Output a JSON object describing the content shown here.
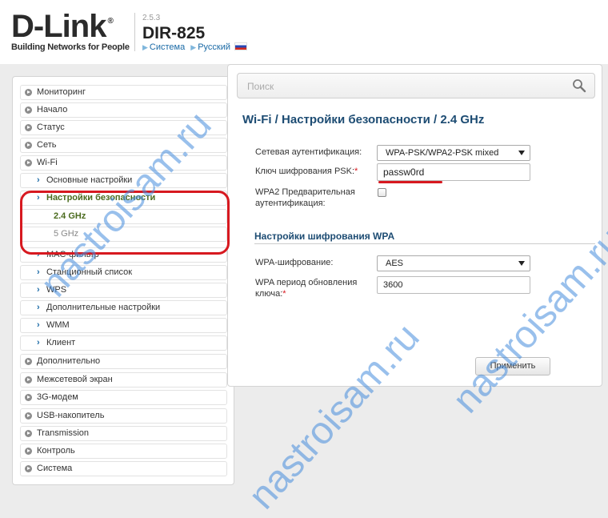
{
  "header": {
    "brand": "D-Link",
    "brand_mark": "®",
    "tagline": "Building Networks for People",
    "firmware": "2.5.3",
    "model": "DIR-825",
    "links": [
      "Система",
      "Русский"
    ]
  },
  "sidebar": {
    "items": [
      {
        "label": "Мониторинг"
      },
      {
        "label": "Начало"
      },
      {
        "label": "Статус"
      },
      {
        "label": "Сеть"
      },
      {
        "label": "Wi-Fi"
      },
      {
        "label": "Основные настройки"
      },
      {
        "label": "Настройки безопасности"
      },
      {
        "label": "2.4 GHz"
      },
      {
        "label": "5 GHz"
      },
      {
        "label": "MAC-фильтр"
      },
      {
        "label": "Станционный список"
      },
      {
        "label": "WPS"
      },
      {
        "label": "Дополнительные настройки"
      },
      {
        "label": "WMM"
      },
      {
        "label": "Клиент"
      },
      {
        "label": "Дополнительно"
      },
      {
        "label": "Межсетевой экран"
      },
      {
        "label": "3G-модем"
      },
      {
        "label": "USB-накопитель"
      },
      {
        "label": "Transmission"
      },
      {
        "label": "Контроль"
      },
      {
        "label": "Система"
      }
    ]
  },
  "search": {
    "placeholder": "Поиск"
  },
  "page": {
    "title": "Wi-Fi /  Настройки безопасности /  2.4 GHz",
    "auth_label": "Сетевая аутентификация:",
    "auth_value": "WPA-PSK/WPA2-PSK mixed",
    "psk_label": "Ключ шифрования PSK:",
    "psk_value": "passw0rd",
    "preauth_label_line1": "WPA2 Предварительная",
    "preauth_label_line2": "аутентификация:",
    "preauth_checked": false,
    "wpa_section": "Настройки шифрования WPA",
    "enc_label": "WPA-шифрование:",
    "enc_value": "AES",
    "period_label_line1": "WPA период обновления",
    "period_label_line2": "ключа:",
    "period_value": "3600",
    "required_mark": "*",
    "apply_button": "Применить"
  },
  "watermark": {
    "text": "nastroisam.ru"
  },
  "colors": {
    "highlight_red": "#d71920",
    "title_blue": "#1d4c73",
    "active_green": "#4b6b1e"
  }
}
